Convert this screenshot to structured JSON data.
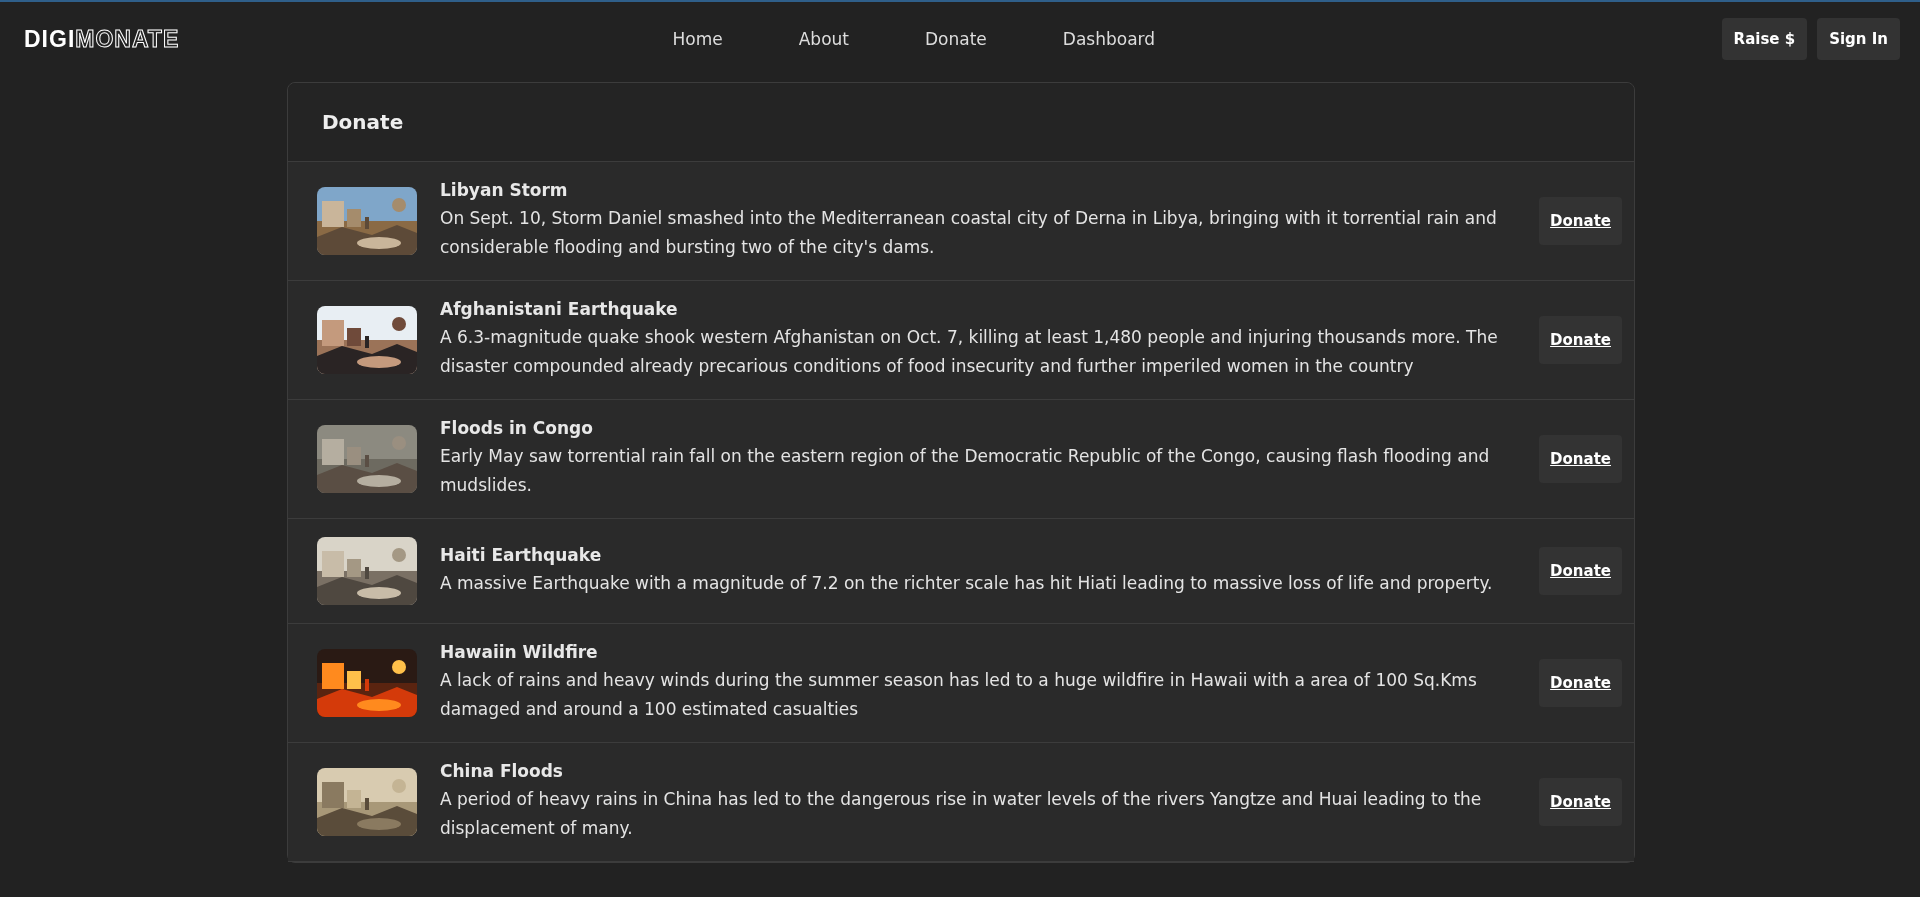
{
  "logo": {
    "filled": "DIGI",
    "outlined": "MONATE"
  },
  "nav": [
    "Home",
    "About",
    "Donate",
    "Dashboard"
  ],
  "actions": [
    "Raise $",
    "Sign In"
  ],
  "card": {
    "title": "Donate",
    "causes": [
      {
        "title": "Libyan Storm",
        "text": "On Sept. 10, Storm Daniel smashed into the Mediterranean coastal city of Derna in Libya, bringing with it torrential rain and considerable flooding and bursting two of the city's dams.",
        "button": "Donate"
      },
      {
        "title": "Afghanistani Earthquake",
        "text": "A 6.3-magnitude quake shook western Afghanistan on Oct. 7, killing at least 1,480 people and injuring thousands more. The disaster compounded already precarious conditions of food insecurity and further imperiled women in the country",
        "button": "Donate"
      },
      {
        "title": "Floods in Congo",
        "text": "Early May saw torrential rain fall on the eastern region of the Democratic Republic of the Congo, causing flash flooding and mudslides.",
        "button": "Donate"
      },
      {
        "title": "Haiti Earthquake",
        "text": "A massive Earthquake with a magnitude of 7.2 on the richter scale has hit Hiati leading to massive loss of life and property.",
        "button": "Donate"
      },
      {
        "title": "Hawaiin Wildfire",
        "text": "A lack of rains and heavy winds during the summer season has led to a huge wildfire in Hawaii with a area of 100 Sq.Kms damaged and around a 100 estimated casualties",
        "button": "Donate"
      },
      {
        "title": "China Floods",
        "text": "A period of heavy rains in China has led to the dangerous rise in water levels of the rivers Yangtze and Huai leading to the displacement of many.",
        "button": "Donate"
      }
    ]
  }
}
